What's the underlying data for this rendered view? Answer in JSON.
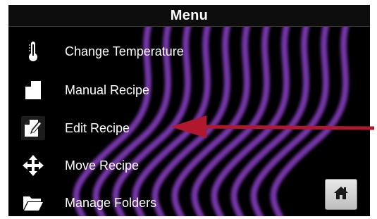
{
  "header": {
    "title": "Menu"
  },
  "menu": {
    "items": [
      {
        "label": "Change Temperature",
        "icon": "thermometer-icon"
      },
      {
        "label": "Manual Recipe",
        "icon": "document-icon"
      },
      {
        "label": "Edit Recipe",
        "icon": "edit-document-icon"
      },
      {
        "label": "Move Recipe",
        "icon": "move-arrows-icon"
      },
      {
        "label": "Manage Folders",
        "icon": "folder-icon"
      }
    ]
  },
  "home_button": {
    "icon": "home-icon"
  },
  "annotation": {
    "icon": "red-pointer-arrow",
    "color": "#b0182f"
  },
  "colors": {
    "background": "#000000",
    "wave": "#8a3fc7",
    "text": "#ffffff"
  }
}
